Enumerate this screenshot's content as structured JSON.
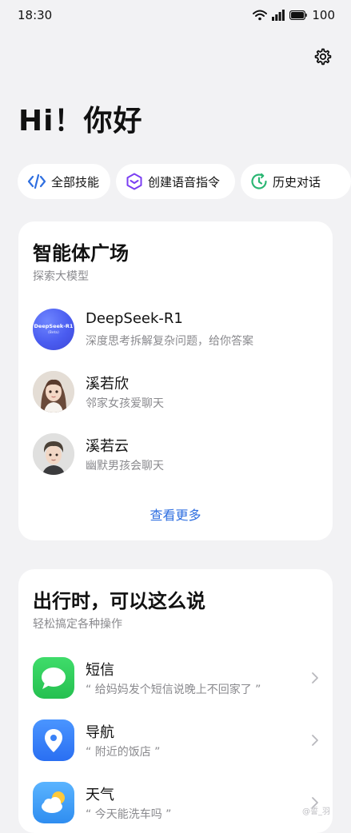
{
  "status_bar": {
    "time": "18:30",
    "battery": "100"
  },
  "greeting": "Hi！你好",
  "chips": [
    {
      "label": "全部技能",
      "icon": "code-icon",
      "color": "#2f6fe0"
    },
    {
      "label": "创建语音指令",
      "icon": "hexagon-command-icon",
      "color": "#7b3ff2"
    },
    {
      "label": "历史对话",
      "icon": "history-clock-icon",
      "color": "#2bb673"
    }
  ],
  "agents_section": {
    "title": "智能体广场",
    "subtitle": "探索大模型",
    "agents": [
      {
        "name": "DeepSeek-R1",
        "desc": "深度思考拆解复杂问题，给你答案",
        "avatar_text": "DeepSeek-R1",
        "avatar_sub": "(Beta)"
      },
      {
        "name": "溪若欣",
        "desc": "邻家女孩爱聊天"
      },
      {
        "name": "溪若云",
        "desc": "幽默男孩会聊天"
      }
    ],
    "see_more": "查看更多"
  },
  "travel_section": {
    "title": "出行时，可以这么说",
    "subtitle": "轻松搞定各种操作",
    "commands": [
      {
        "name": "短信",
        "desc": "“ 给妈妈发个短信说晚上不回家了 ”",
        "icon": "message-bubble-icon",
        "color": "#31c95a"
      },
      {
        "name": "导航",
        "desc": "“ 附近的饭店 ”",
        "icon": "location-pin-icon",
        "color": "#2f7cf6"
      },
      {
        "name": "天气",
        "desc": "“ 今天能洗车吗 ”",
        "icon": "weather-cloud-sun-icon",
        "color": "#3b9cf5"
      }
    ]
  },
  "watermark": "@誓_羽"
}
